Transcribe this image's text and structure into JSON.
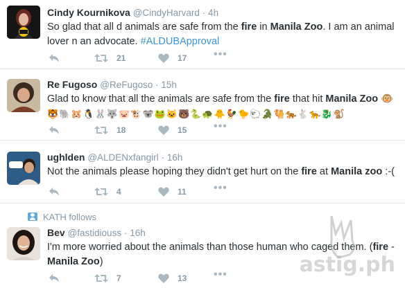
{
  "tweets": [
    {
      "name": "Cindy Kournikova",
      "handle": "@CindyHarvard",
      "time": "· 4h",
      "text_parts": [
        "So glad that all d animals are safe from the ",
        "fire",
        " in ",
        "Manila Zoo",
        ". I am an animal lover n an advocate. ",
        "#ALDUBApproval"
      ],
      "retweets": "21",
      "likes": "17"
    },
    {
      "name": "Re Fugoso",
      "handle": "@ReFugoso",
      "time": "· 15h",
      "text_parts": [
        "Glad to know that all the animals are safe from the ",
        "fire",
        " that hit ",
        "Manila Zoo",
        " 🐵"
      ],
      "emoji_line": "🐯🐘🐹🐧🐰🐺🐷🐮🐨🐸🐱🐻🐍🐢🐥🐓🐤🐑🐊🐫🐅🐇🐆🐉🐒",
      "retweets": "18",
      "likes": "15"
    },
    {
      "name": "ughlden",
      "handle": "@ALDENxfangirl",
      "time": "· 16h",
      "text_parts": [
        "Not the animals please hoping they didn't get hurt on the ",
        "fire",
        " at ",
        "Manila zoo",
        " :-("
      ],
      "retweets": "4",
      "likes": "11"
    },
    {
      "follows": "KATH follows",
      "name": "Bev",
      "handle": "@fastidiouss",
      "time": "· 16h",
      "text_parts": [
        "I'm more worried about the animals than those human who caged them. (",
        "fire",
        " - ",
        "Manila Zoo",
        ")"
      ],
      "retweets": "7",
      "likes": "13"
    }
  ],
  "icons": {
    "reply": "reply-icon",
    "retweet": "retweet-icon",
    "like": "heart-icon",
    "more": "more-icon"
  },
  "colors": {
    "name": "#292f33",
    "meta": "#8899a6",
    "hashtag": "#3b94d9",
    "icon": "#aab8c2",
    "divider": "#e1e8ed"
  },
  "watermark": "astig.ph"
}
